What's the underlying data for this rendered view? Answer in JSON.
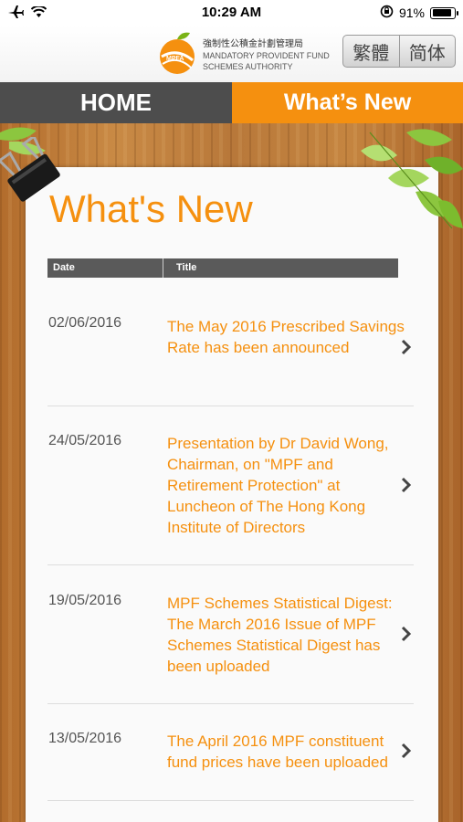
{
  "status_bar": {
    "time": "10:29 AM",
    "battery": "91%"
  },
  "header": {
    "logo_zh": "強制性公積金計劃管理局",
    "logo_en_line1": "MANDATORY PROVIDENT FUND",
    "logo_en_line2": "SCHEMES AUTHORITY",
    "lang_traditional": "繁體",
    "lang_simplified": "简体"
  },
  "nav": {
    "home_label": "HOME",
    "whatsnew_label": "What’s New"
  },
  "page": {
    "title": "What's New"
  },
  "table": {
    "col_date": "Date",
    "col_title": "Title",
    "rows": [
      {
        "date": "02/06/2016",
        "title": "The May 2016 Prescribed Savings Rate has been announced"
      },
      {
        "date": "24/05/2016",
        "title": "Presentation by Dr David Wong, Chairman, on \"MPF and Retirement Protection\" at Luncheon of The Hong Kong Institute of Directors"
      },
      {
        "date": "19/05/2016",
        "title": "MPF Schemes Statistical Digest: The March 2016 Issue of MPF Schemes Statistical Digest has been uploaded"
      },
      {
        "date": "13/05/2016",
        "title": "The April 2016 MPF constituent fund prices have been uploaded"
      }
    ]
  },
  "colors": {
    "accent": "#f5900f",
    "nav_dark": "#4d4d4d"
  }
}
